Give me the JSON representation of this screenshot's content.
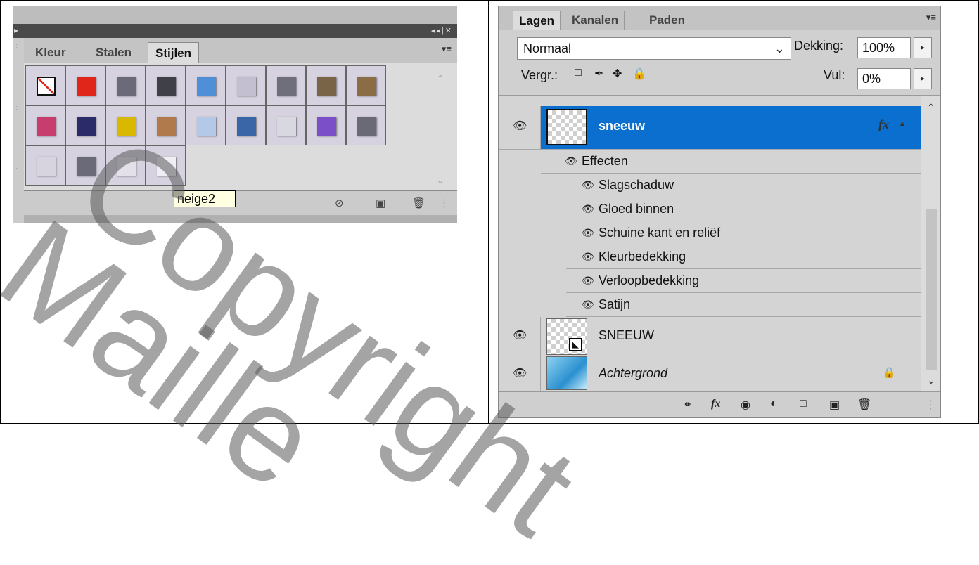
{
  "styles_panel": {
    "tabs": [
      "Kleur",
      "Stalen",
      "Stijlen"
    ],
    "active_tab": "Stijlen",
    "menu_icon": "panel-menu-icon",
    "tooltip": "neige2",
    "swatch_colors": [
      "#ffffff",
      "#e0251b",
      "#6a6a78",
      "#404048",
      "#4f8fd8",
      "#c4bfd0",
      "#6f6f7c",
      "#7a6448",
      "#8a6d45",
      "#c73d6d",
      "#2b2b6a",
      "#d8b800",
      "#b07a4c",
      "#b4c8e8",
      "#3a66a8",
      "#d8d8e0",
      "#7a4fc8",
      "#6a6a76",
      "#d7d4e0",
      "#6a6a78",
      "#e3e0ea",
      "#eeeef4"
    ],
    "bottom_icons": [
      "clear-style-icon",
      "new-style-icon",
      "delete-icon"
    ]
  },
  "layers_panel": {
    "tabs": [
      "Lagen",
      "Kanalen",
      "Paden"
    ],
    "active_tab": "Lagen",
    "blend_mode": "Normaal",
    "opacity_label": "Dekking:",
    "opacity_value": "100%",
    "lock_label": "Vergr.:",
    "fill_label": "Vul:",
    "fill_value": "0%",
    "layers": [
      {
        "name": "sneeuw",
        "selected": true,
        "fx": true
      },
      {
        "name": "SNEEUW",
        "selected": false
      },
      {
        "name": "Achtergrond",
        "selected": false,
        "locked": true,
        "italic": true
      }
    ],
    "effects_header": "Effecten",
    "effects": [
      "Slagschaduw",
      "Gloed binnen",
      "Schuine kant en reliëf",
      "Kleurbedekking",
      "Verloopbedekking",
      "Satijn"
    ],
    "fx_label": "fx",
    "bottom_icons": [
      "link-icon",
      "fx-icon",
      "mask-icon",
      "adjustment-icon",
      "group-icon",
      "new-layer-icon",
      "delete-icon"
    ]
  },
  "watermark": {
    "line1": "Copyright",
    "line2": "Maille"
  }
}
